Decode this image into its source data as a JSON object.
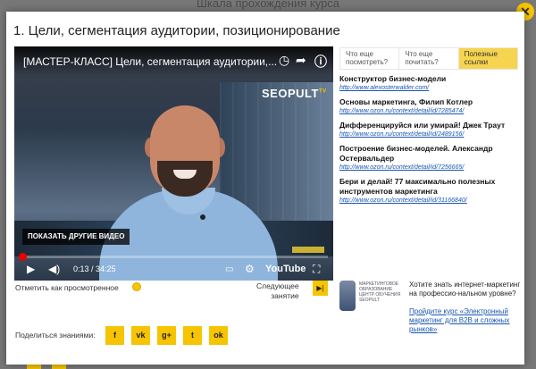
{
  "background": {
    "page_title": "Шкала прохождения курса"
  },
  "lesson": {
    "title": "1. Цели, сегментация аудитории, позиционирование"
  },
  "video": {
    "title": "[МАСТЕР-КЛАСС] Цели, сегментация аудитории,...",
    "channel_logo": "SEOPULT",
    "channel_logo_sup": "TV",
    "more_videos": "ПОКАЗАТЬ ДРУГИЕ ВИДЕО",
    "current_time": "0:13",
    "duration": "34:25",
    "time_display": "0:13 / 34:25",
    "progress_fraction": 0.006,
    "youtube_label": "YouTube",
    "icons": [
      "clock-icon",
      "share-icon",
      "info-icon",
      "play-icon",
      "volume-icon",
      "subtitles-icon",
      "settings-icon",
      "fullscreen-icon"
    ]
  },
  "tabs": [
    {
      "label": "Что еще посмотреть?",
      "active": false
    },
    {
      "label": "Что еще почитать?",
      "active": false
    },
    {
      "label": "Полезные ссылки",
      "active": true
    }
  ],
  "links": [
    {
      "title": "Конструктор бизнес-модели",
      "url": "http://www.alexosterwalder.com/"
    },
    {
      "title": "Основы маркетинга, Филип Котлер",
      "url": "http://www.ozon.ru/context/detail/id/7285474/"
    },
    {
      "title": "Дифференцируйся или умирай! Джек Траут",
      "url": "http://www.ozon.ru/context/detail/id/2489156/"
    },
    {
      "title": "Построение бизнес-моделей. Александр Остервальдер",
      "url": "http://www.ozon.ru/context/detail/id/7256665/"
    },
    {
      "title": "Бери и делай! 77 максимально полезных инструментов маркетинга",
      "url": "http://www.ozon.ru/context/detail/id/31166840/"
    }
  ],
  "actions": {
    "mark_watched": "Отметить как просмотренное",
    "next_line1": "Следующее",
    "next_line2": "занятие",
    "share_label": "Поделиться знаниями:"
  },
  "social": [
    {
      "icon": "facebook-icon",
      "glyph": "f"
    },
    {
      "icon": "vk-icon",
      "glyph": "vk"
    },
    {
      "icon": "googleplus-icon",
      "glyph": "g+"
    },
    {
      "icon": "twitter-icon",
      "glyph": "t"
    },
    {
      "icon": "odnoklassniki-icon",
      "glyph": "ok"
    }
  ],
  "promo": {
    "org": "МАРКЕТИНГОВОЕ ОБРАЗОВАНИЕ ЦЕНТР ОБУЧЕНИЯ SEOPULT",
    "text": "Хотите знать интернет-маркетинг на профессио-нальном уровне?",
    "link": "Пройдите курс «Электронный маркетинг для B2B и сложных рынков»"
  },
  "colors": {
    "accent": "#f6c400",
    "link": "#1a56b0",
    "progress": "#ee0000"
  }
}
